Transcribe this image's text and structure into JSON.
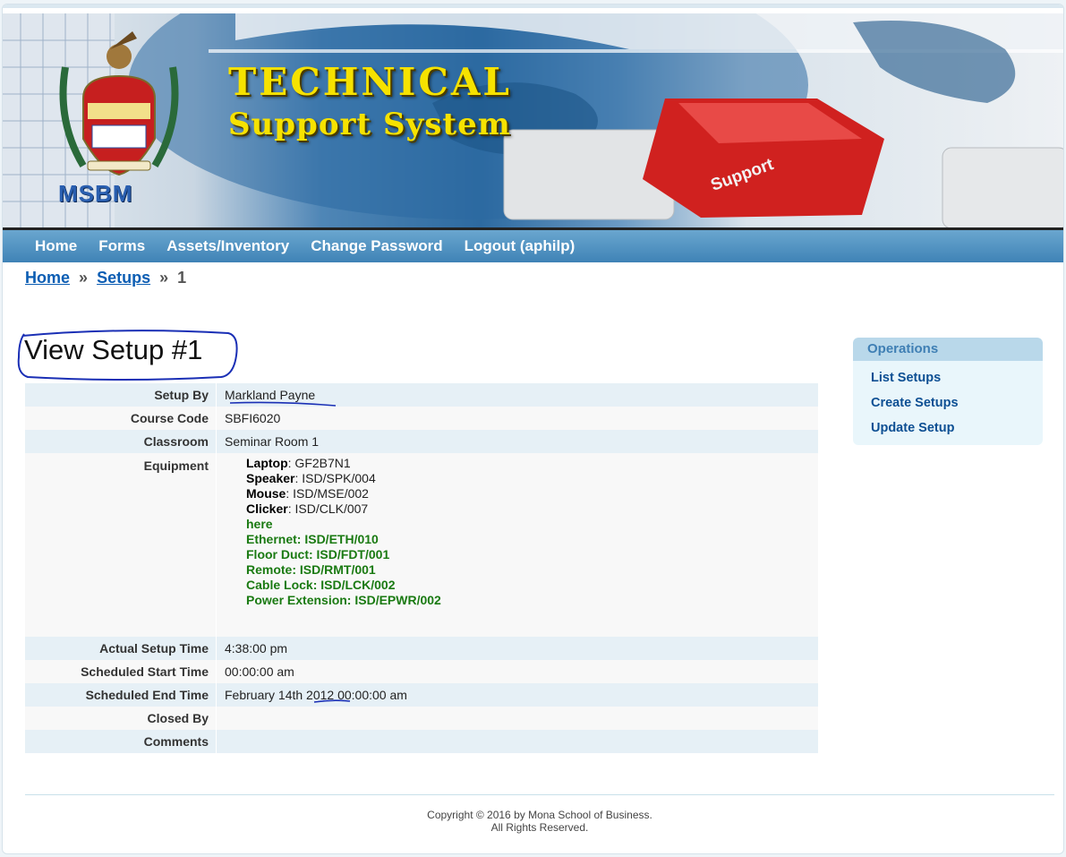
{
  "banner": {
    "title_line1": "TECHNICAL",
    "title_line2": "Support System",
    "logo_text": "MSBM",
    "key_label": "Support"
  },
  "nav": {
    "items": [
      {
        "label": "Home"
      },
      {
        "label": "Forms"
      },
      {
        "label": "Assets/Inventory"
      },
      {
        "label": "Change Password"
      },
      {
        "label": "Logout (aphilp)"
      }
    ]
  },
  "breadcrumb": {
    "home": "Home",
    "setups": "Setups",
    "current": "1",
    "separator": "»"
  },
  "page_title": "View Setup #1",
  "details": {
    "setup_by": {
      "label": "Setup By",
      "value": "Markland Payne"
    },
    "course_code": {
      "label": "Course Code",
      "value": "SBFI6020"
    },
    "classroom": {
      "label": "Classroom",
      "value": "Seminar Room 1"
    },
    "equipment": {
      "label": "Equipment",
      "items": [
        {
          "name": "Laptop",
          "value": ": GF2B7N1"
        },
        {
          "name": "Speaker",
          "value": ": ISD/SPK/004"
        },
        {
          "name": "Mouse",
          "value": ": ISD/MSE/002"
        },
        {
          "name": "Clicker",
          "value": ": ISD/CLK/007"
        }
      ],
      "extra_items": [
        "here",
        "Ethernet: ISD/ETH/010",
        "Floor Duct: ISD/FDT/001",
        "Remote: ISD/RMT/001",
        "Cable Lock: ISD/LCK/002",
        "Power Extension: ISD/EPWR/002"
      ]
    },
    "actual_setup_time": {
      "label": "Actual Setup Time",
      "value": "4:38:00 pm"
    },
    "scheduled_start_time": {
      "label": "Scheduled Start Time",
      "value": "00:00:00 am"
    },
    "scheduled_end_time": {
      "label": "Scheduled End Time",
      "value": "February 14th 2012 00:00:00 am"
    },
    "closed_by": {
      "label": "Closed By",
      "value": ""
    },
    "comments": {
      "label": "Comments",
      "value": ""
    }
  },
  "operations": {
    "title": "Operations",
    "items": [
      {
        "label": "List Setups"
      },
      {
        "label": "Create Setups"
      },
      {
        "label": "Update Setup"
      }
    ]
  },
  "footer": {
    "line1": "Copyright © 2016 by Mona School of Business.",
    "line2": "All Rights Reserved."
  },
  "colors": {
    "nav_bar": "#4a8fc0",
    "link": "#0b5db3",
    "green_items": "#1a7a12",
    "title_yellow": "#f6e200",
    "annotation_ink": "#1a2fb5"
  }
}
